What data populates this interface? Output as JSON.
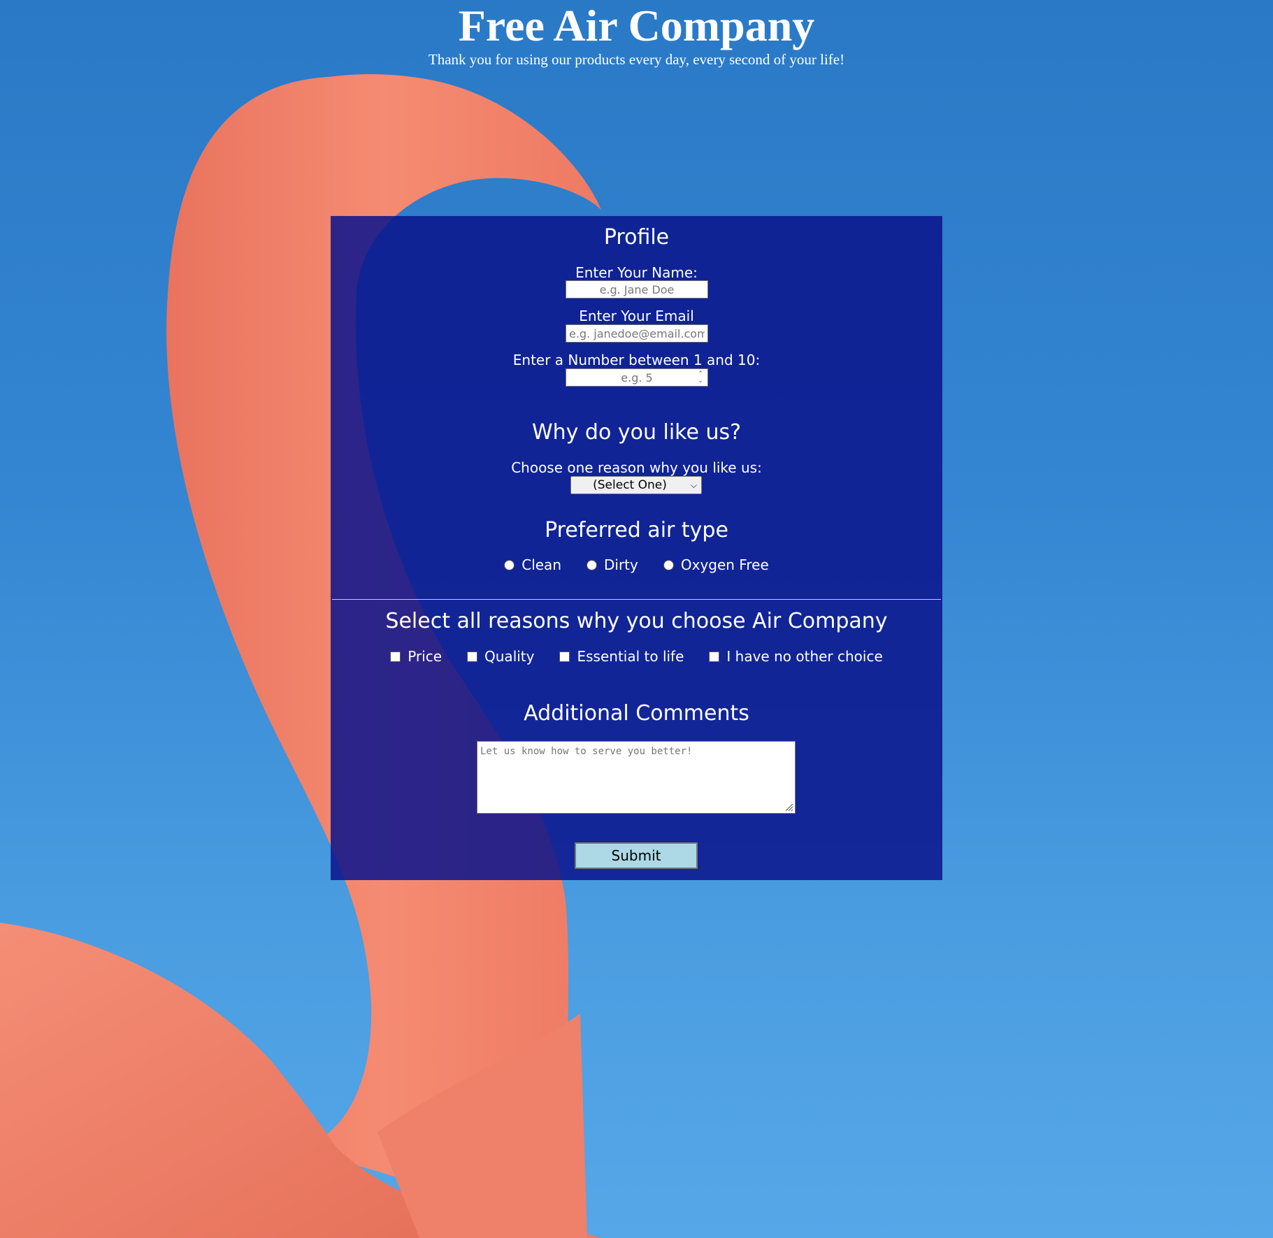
{
  "header": {
    "title": "Free Air Company",
    "tagline": "Thank you for using our products every day, every second of your life!"
  },
  "profile": {
    "heading": "Profile",
    "name_label": "Enter Your Name:",
    "name_placeholder": "e.g. Jane Doe",
    "email_label": "Enter Your Email",
    "email_placeholder": "e.g. janedoe@email.com",
    "number_label": "Enter a Number between 1 and 10:",
    "number_placeholder": "e.g. 5"
  },
  "why": {
    "heading": "Why do you like us?",
    "select_label": "Choose one reason why you like us:",
    "select_value": "(Select One)"
  },
  "air_type": {
    "heading": "Preferred air type",
    "options": [
      "Clean",
      "Dirty",
      "Oxygen Free"
    ]
  },
  "reasons": {
    "heading": "Select all reasons why you choose Air Company",
    "options": [
      "Price",
      "Quality",
      "Essential to life",
      "I have no other choice"
    ]
  },
  "comments": {
    "heading": "Additional Comments",
    "placeholder": "Let us know how to serve you better!"
  },
  "submit_label": "Submit",
  "colors": {
    "panel": "#0a148c",
    "submit": "#add8e6",
    "sky": "#3486d2",
    "flamingo": "#f2876e"
  }
}
